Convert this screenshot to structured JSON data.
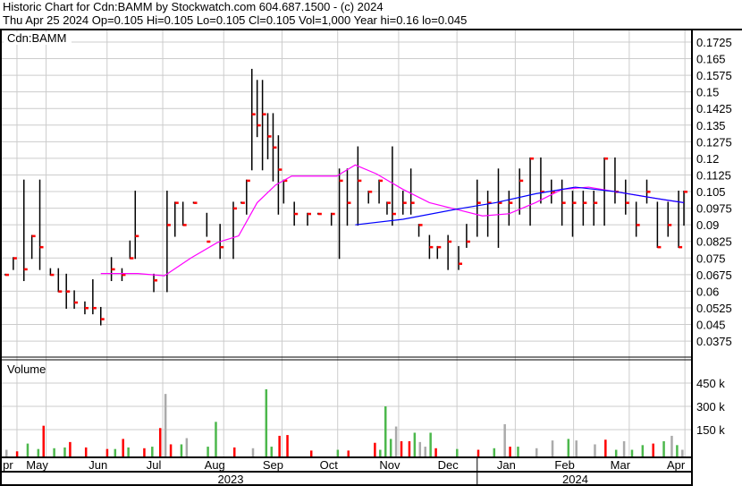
{
  "header": {
    "title": "Historic Chart for Cdn:BAMM by Stockwatch.com 604.687.1500 - (c) 2024",
    "quote": "Thu Apr 25 2024   Op=0.105   Hi=0.105   Lo=0.105   Cl=0.105   Vol=1,000   Year hi=0.16   lo=0.045"
  },
  "chart_data": [
    {
      "type": "ohlc",
      "title": "Cdn:BAMM",
      "ylim": [
        0.03,
        0.18
      ],
      "yticks": [
        "0.1725",
        "0.165",
        "0.1575",
        "0.15",
        "0.1425",
        "0.135",
        "0.1275",
        "0.12",
        "0.1125",
        "0.105",
        "0.0975",
        "0.09",
        "0.0825",
        "0.075",
        "0.0675",
        "0.06",
        "0.0525",
        "0.045",
        "0.0375"
      ],
      "xlim": [
        0,
        257
      ],
      "bars": [
        [
          0,
          0.0675,
          0.0675,
          0.0675
        ],
        [
          3,
          0.075,
          0.07,
          0.075
        ],
        [
          7,
          0.11,
          0.065,
          0.07
        ],
        [
          10,
          0.085,
          0.075,
          0.085
        ],
        [
          13,
          0.11,
          0.07,
          0.08
        ],
        [
          17,
          0.07,
          0.0675,
          0.0675
        ],
        [
          20,
          0.07,
          0.06,
          0.06
        ],
        [
          23,
          0.0675,
          0.0525,
          0.06
        ],
        [
          26,
          0.06,
          0.0525,
          0.055
        ],
        [
          30,
          0.055,
          0.05,
          0.0525
        ],
        [
          33,
          0.065,
          0.05,
          0.0525
        ],
        [
          36,
          0.0525,
          0.045,
          0.0475
        ],
        [
          40,
          0.075,
          0.065,
          0.07
        ],
        [
          44,
          0.07,
          0.065,
          0.0675
        ],
        [
          47,
          0.0825,
          0.075,
          0.075
        ],
        [
          49,
          0.105,
          0.075,
          0.085
        ],
        [
          56,
          0.0675,
          0.06,
          0.065
        ],
        [
          61,
          0.105,
          0.06,
          0.09
        ],
        [
          64,
          0.1,
          0.085,
          0.1
        ],
        [
          67,
          0.1,
          0.09,
          0.09
        ],
        [
          71,
          0.1,
          0.1,
          0.1
        ],
        [
          76,
          0.095,
          0.085,
          0.0825
        ],
        [
          81,
          0.09,
          0.075,
          0.08
        ],
        [
          86,
          0.1,
          0.075,
          0.0975
        ],
        [
          89,
          0.1,
          0.1,
          0.1
        ],
        [
          91,
          0.11,
          0.095,
          0.11
        ],
        [
          93,
          0.16,
          0.115,
          0.14
        ],
        [
          95,
          0.155,
          0.13,
          0.135
        ],
        [
          97,
          0.155,
          0.115,
          0.14
        ],
        [
          99,
          0.14,
          0.12,
          0.13
        ],
        [
          101,
          0.14,
          0.11,
          0.125
        ],
        [
          103,
          0.13,
          0.095,
          0.115
        ],
        [
          105,
          0.11,
          0.1,
          0.11
        ],
        [
          109,
          0.1,
          0.09,
          0.095
        ],
        [
          114,
          0.095,
          0.09,
          0.095
        ],
        [
          118,
          0.095,
          0.095,
          0.095
        ],
        [
          123,
          0.095,
          0.09,
          0.095
        ],
        [
          126,
          0.115,
          0.075,
          0.11
        ],
        [
          129,
          0.115,
          0.09,
          0.1
        ],
        [
          133,
          0.125,
          0.09,
          0.11
        ],
        [
          137,
          0.105,
          0.1,
          0.105
        ],
        [
          141,
          0.11,
          0.1,
          0.11
        ],
        [
          144,
          0.1,
          0.095,
          0.1
        ],
        [
          146,
          0.125,
          0.09,
          0.095
        ],
        [
          150,
          0.105,
          0.095,
          0.1
        ],
        [
          153,
          0.115,
          0.095,
          0.1
        ],
        [
          156,
          0.09,
          0.085,
          0.09
        ],
        [
          160,
          0.085,
          0.075,
          0.08
        ],
        [
          163,
          0.08,
          0.075,
          0.08
        ],
        [
          167,
          0.085,
          0.07,
          0.0825
        ],
        [
          171,
          0.08,
          0.07,
          0.0725
        ],
        [
          174,
          0.09,
          0.08,
          0.0825
        ],
        [
          178,
          0.11,
          0.085,
          0.1
        ],
        [
          182,
          0.105,
          0.085,
          0.1
        ],
        [
          186,
          0.115,
          0.08,
          0.1
        ],
        [
          190,
          0.105,
          0.09,
          0.1
        ],
        [
          194,
          0.115,
          0.095,
          0.11
        ],
        [
          198,
          0.12,
          0.09,
          0.12
        ],
        [
          202,
          0.12,
          0.1,
          0.105
        ],
        [
          206,
          0.11,
          0.1,
          0.105
        ],
        [
          210,
          0.11,
          0.09,
          0.1
        ],
        [
          214,
          0.105,
          0.085,
          0.1
        ],
        [
          218,
          0.105,
          0.09,
          0.1
        ],
        [
          222,
          0.105,
          0.09,
          0.1
        ],
        [
          226,
          0.12,
          0.09,
          0.12
        ],
        [
          230,
          0.12,
          0.1,
          0.105
        ],
        [
          234,
          0.11,
          0.095,
          0.1
        ],
        [
          238,
          0.1,
          0.085,
          0.09
        ],
        [
          242,
          0.11,
          0.1,
          0.105
        ],
        [
          246,
          0.1,
          0.08,
          0.08
        ],
        [
          250,
          0.1,
          0.085,
          0.09
        ],
        [
          254,
          0.105,
          0.08,
          0.08
        ],
        [
          256,
          0.105,
          0.09,
          0.105
        ]
      ],
      "ma_short": [
        [
          36,
          0.068
        ],
        [
          50,
          0.068
        ],
        [
          60,
          0.067
        ],
        [
          70,
          0.075
        ],
        [
          80,
          0.082
        ],
        [
          88,
          0.085
        ],
        [
          95,
          0.1
        ],
        [
          102,
          0.108
        ],
        [
          108,
          0.112
        ],
        [
          120,
          0.112
        ],
        [
          125,
          0.112
        ],
        [
          132,
          0.117
        ],
        [
          140,
          0.113
        ],
        [
          150,
          0.106
        ],
        [
          160,
          0.1
        ],
        [
          170,
          0.097
        ],
        [
          180,
          0.094
        ],
        [
          190,
          0.095
        ],
        [
          200,
          0.1
        ],
        [
          210,
          0.106
        ],
        [
          220,
          0.107
        ],
        [
          230,
          0.105
        ],
        [
          240,
          0.103
        ],
        [
          250,
          0.101
        ],
        [
          256,
          0.1
        ]
      ],
      "ma_long": [
        [
          132,
          0.09
        ],
        [
          150,
          0.0925
        ],
        [
          170,
          0.097
        ],
        [
          185,
          0.1
        ],
        [
          200,
          0.104
        ],
        [
          215,
          0.107
        ],
        [
          230,
          0.105
        ],
        [
          245,
          0.102
        ],
        [
          256,
          0.1
        ]
      ],
      "colors": {
        "up": "#000000",
        "down": "#ff0000",
        "ma_short": "#ff00ff",
        "ma_long": "#0000ff"
      }
    },
    {
      "type": "bar",
      "title": "Volume",
      "yticks": [
        "450 k",
        "300 k",
        "150 k"
      ],
      "ylim": [
        0,
        500
      ],
      "values_k": [
        [
          0,
          20,
          "gray"
        ],
        [
          4,
          10,
          "red"
        ],
        [
          8,
          60,
          "green"
        ],
        [
          12,
          25,
          "green"
        ],
        [
          14,
          175,
          "red"
        ],
        [
          18,
          30,
          "green"
        ],
        [
          22,
          35,
          "green"
        ],
        [
          24,
          70,
          "red"
        ],
        [
          30,
          35,
          "red"
        ],
        [
          38,
          25,
          "red"
        ],
        [
          41,
          25,
          "green"
        ],
        [
          44,
          90,
          "red"
        ],
        [
          46,
          35,
          "green"
        ],
        [
          52,
          30,
          "red"
        ],
        [
          55,
          40,
          "green"
        ],
        [
          58,
          160,
          "red"
        ],
        [
          60,
          380,
          "gray"
        ],
        [
          62,
          55,
          "red"
        ],
        [
          66,
          55,
          "green"
        ],
        [
          68,
          95,
          "gray"
        ],
        [
          76,
          40,
          "green"
        ],
        [
          79,
          200,
          "green"
        ],
        [
          86,
          35,
          "red"
        ],
        [
          93,
          30,
          "gray"
        ],
        [
          98,
          410,
          "green"
        ],
        [
          100,
          40,
          "green"
        ],
        [
          103,
          110,
          "red"
        ],
        [
          106,
          115,
          "red"
        ],
        [
          115,
          15,
          "red"
        ],
        [
          125,
          20,
          "green"
        ],
        [
          129,
          15,
          "red"
        ],
        [
          139,
          65,
          "red"
        ],
        [
          141,
          20,
          "green"
        ],
        [
          143,
          300,
          "green"
        ],
        [
          145,
          90,
          "green"
        ],
        [
          147,
          170,
          "gray"
        ],
        [
          149,
          75,
          "red"
        ],
        [
          152,
          75,
          "red"
        ],
        [
          154,
          130,
          "green"
        ],
        [
          156,
          70,
          "gray"
        ],
        [
          158,
          40,
          "gray"
        ],
        [
          160,
          130,
          "green"
        ],
        [
          162,
          30,
          "red"
        ],
        [
          170,
          25,
          "green"
        ],
        [
          178,
          20,
          "red"
        ],
        [
          184,
          30,
          "green"
        ],
        [
          188,
          185,
          "gray"
        ],
        [
          190,
          40,
          "red"
        ],
        [
          193,
          40,
          "green"
        ],
        [
          200,
          30,
          "gray"
        ],
        [
          206,
          80,
          "gray"
        ],
        [
          212,
          90,
          "green"
        ],
        [
          215,
          80,
          "gray"
        ],
        [
          222,
          55,
          "gray"
        ],
        [
          226,
          85,
          "red"
        ],
        [
          230,
          20,
          "green"
        ],
        [
          233,
          75,
          "gray"
        ],
        [
          236,
          20,
          "green"
        ],
        [
          240,
          50,
          "green"
        ],
        [
          244,
          60,
          "red"
        ],
        [
          248,
          75,
          "green"
        ],
        [
          251,
          110,
          "gray"
        ],
        [
          253,
          50,
          "green"
        ],
        [
          255,
          20,
          "gray"
        ]
      ]
    }
  ],
  "xaxis": {
    "months": [
      [
        "pr",
        1
      ],
      [
        "May",
        12
      ],
      [
        "Jun",
        35
      ],
      [
        "Jul",
        56
      ],
      [
        "Aug",
        79
      ],
      [
        "Sep",
        101
      ],
      [
        "Oct",
        122
      ],
      [
        "Nov",
        145
      ],
      [
        "Dec",
        167
      ],
      [
        "Jan",
        189
      ],
      [
        "Feb",
        211
      ],
      [
        "Mar",
        232
      ],
      [
        "Apr",
        253
      ]
    ],
    "years": [
      [
        "2023",
        85
      ],
      [
        "2024",
        215
      ]
    ],
    "year_split": 178
  }
}
